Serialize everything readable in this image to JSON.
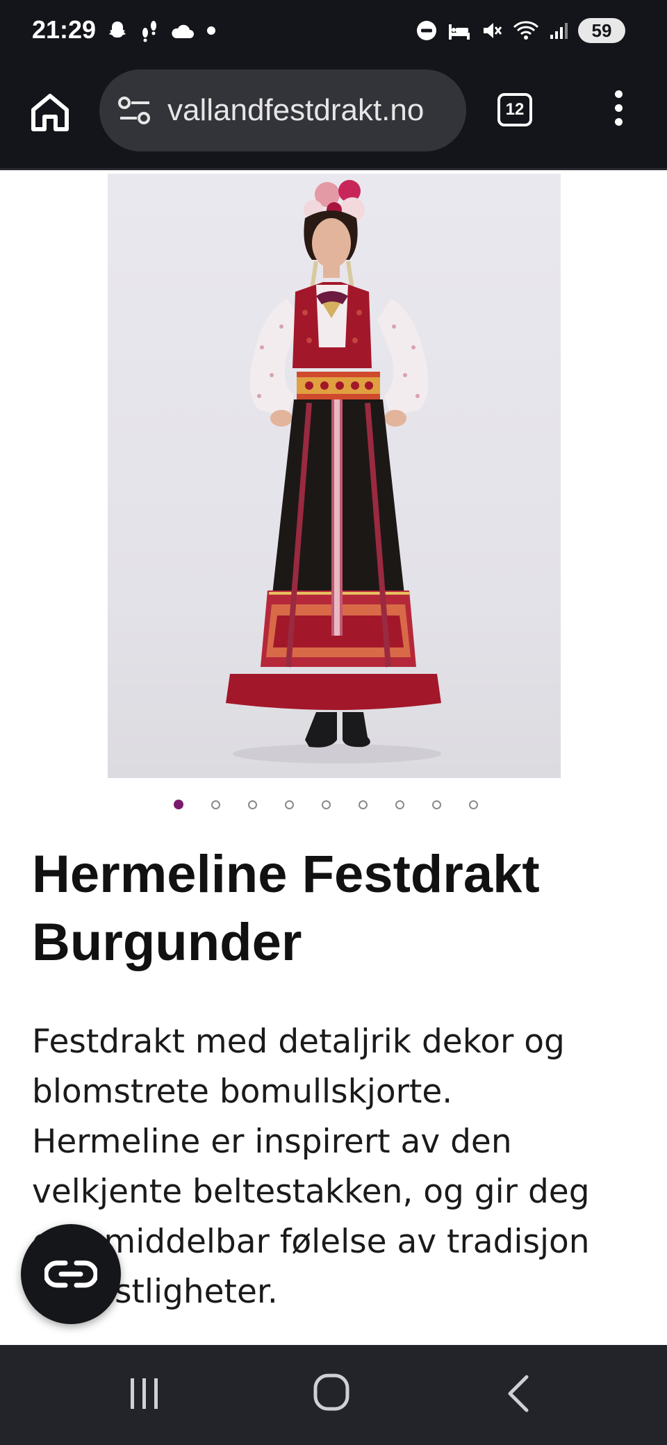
{
  "status_bar": {
    "time": "21:29",
    "left_icons": [
      "snapchat-icon",
      "steps-icon",
      "cloud-icon",
      "dot-icon"
    ],
    "right_icons": [
      "do-not-disturb-icon",
      "bed-icon",
      "mute-icon",
      "wifi-icon",
      "signal-icon"
    ],
    "battery": "59"
  },
  "browser": {
    "url": "vallandfestdrakt.no",
    "tab_count": "12"
  },
  "product": {
    "carousel": {
      "total": 9,
      "active_index": 0
    },
    "title": "Hermeline Festdrakt Burgunder",
    "description": "Festdrakt med detaljrik dekor og blomstrete bomullskjorte. Hermeline er inspirert av den velkjente beltestakken, og gir deg en umiddelbar følelse av tradisjon og festligheter."
  },
  "colors": {
    "accent": "#7a1a6e",
    "chrome": "#14151a",
    "burgundy": "#a3172a"
  }
}
